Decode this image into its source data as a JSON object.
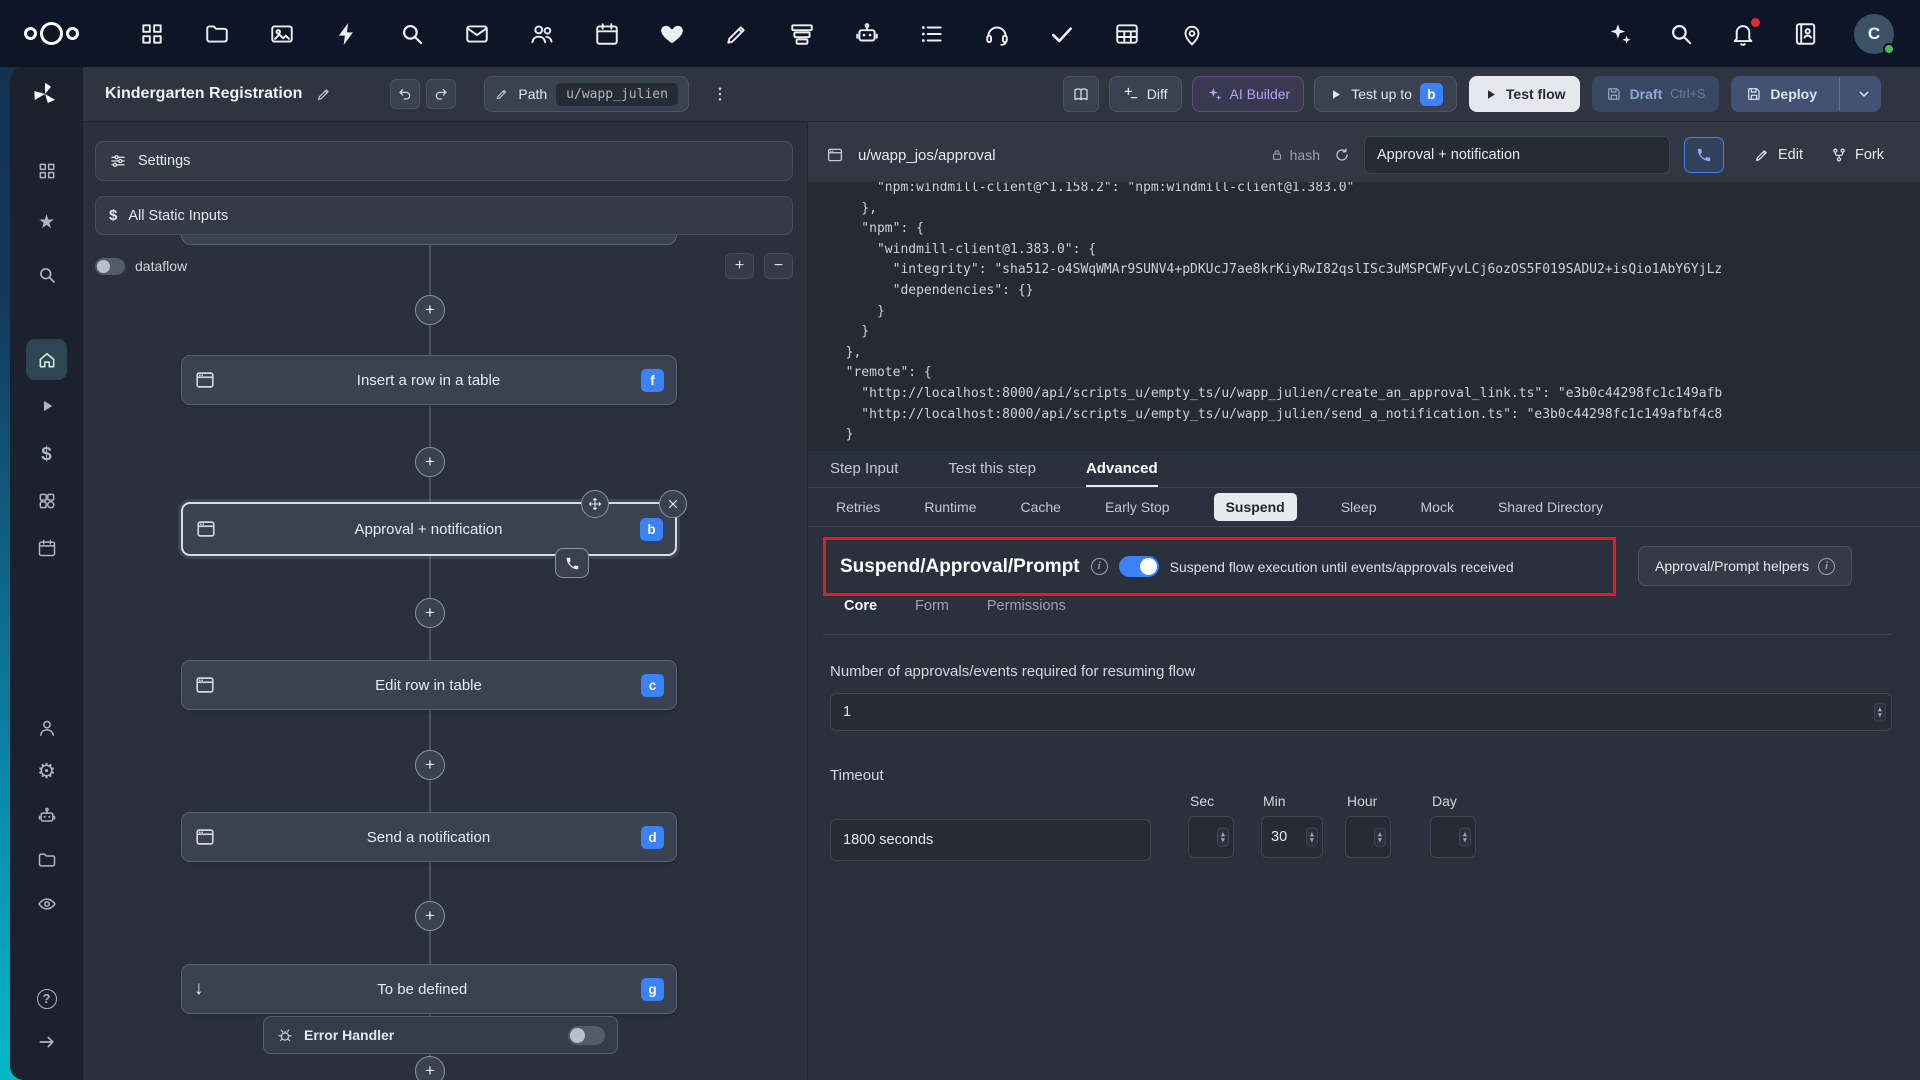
{
  "topbar": {
    "logo": "nextcloud-logo",
    "app_icons": [
      "dashboard",
      "files",
      "photos",
      "activity",
      "search-app",
      "mail",
      "contacts",
      "calendar",
      "health",
      "notes",
      "deck",
      "assistant",
      "tasks-list",
      "talk",
      "tasks",
      "tables",
      "maps"
    ],
    "right_icons": [
      "ai-sparkles",
      "unified-search",
      "notifications",
      "contacts-menu"
    ],
    "avatar_letter": "C"
  },
  "sidebar": {
    "icons": [
      "windmill-logo",
      "apps",
      "favorites",
      "search",
      "home",
      "runs",
      "variables",
      "resources",
      "schedules",
      "users",
      "settings",
      "workers",
      "folders",
      "audit-logs",
      "help",
      "expand"
    ],
    "active": "home"
  },
  "header": {
    "flow_title": "Kindergarten Registration",
    "path_label": "Path",
    "path_value": "u/wapp_julien",
    "diff_label": "Diff",
    "ai_builder_label": "AI Builder",
    "test_up_to_label": "Test up to",
    "test_up_to_badge": "b",
    "test_flow_label": "Test flow",
    "draft_label": "Draft",
    "draft_shortcut": "Ctrl+S",
    "deploy_label": "Deploy"
  },
  "flow_panel": {
    "settings_label": "Settings",
    "static_inputs_label": "All Static Inputs",
    "dataflow_label": "dataflow",
    "zoom_in": "+",
    "zoom_out": "−",
    "plus": "+",
    "tbd_arrow": "↓",
    "nodes": [
      {
        "label": "Insert a row in a table",
        "badge": "f"
      },
      {
        "label": "Approval + notification",
        "badge": "b"
      },
      {
        "label": "Edit row in table",
        "badge": "c"
      },
      {
        "label": "Send a notification",
        "badge": "d"
      },
      {
        "label": "To be defined",
        "badge": "g"
      }
    ],
    "error_handler_label": "Error Handler"
  },
  "step_panel": {
    "script_path": "u/wapp_jos/approval",
    "hash_label": "hash",
    "summary_value": "Approval + notification",
    "edit_label": "Edit",
    "fork_label": "Fork",
    "code": "      \"npm:windmill-client@^1.158.2\": \"npm:windmill-client@1.383.0\"\n    },\n    \"npm\": {\n      \"windmill-client@1.383.0\": {\n        \"integrity\": \"sha512-o4SWqWMAr9SUNV4+pDKUcJ7ae8krKiyRwI82qslISc3uMSPCWFyvLCj6ozOS5F019SADU2+isQio1AbY6YjLz\n        \"dependencies\": {}\n      }\n    }\n  },\n  \"remote\": {\n    \"http://localhost:8000/api/scripts_u/empty_ts/u/wapp_julien/create_an_approval_link.ts\": \"e3b0c44298fc1c149afb\n    \"http://localhost:8000/api/scripts_u/empty_ts/u/wapp_julien/send_a_notification.ts\": \"e3b0c44298fc1c149afbf4c8\n  }",
    "tabs": [
      "Step Input",
      "Test this step",
      "Advanced"
    ],
    "active_tab": "Advanced",
    "advanced_tabs": [
      "Retries",
      "Runtime",
      "Cache",
      "Early Stop",
      "Suspend",
      "Sleep",
      "Mock",
      "Shared Directory"
    ],
    "active_advanced_tab": "Suspend",
    "suspend": {
      "title": "Suspend/Approval/Prompt",
      "toggle_on": true,
      "description": "Suspend flow execution until events/approvals received",
      "helpers_label": "Approval/Prompt helpers",
      "tabs": [
        "Core",
        "Form",
        "Permissions"
      ],
      "active_tab": "Core",
      "approvals_label": "Number of approvals/events required for resuming flow",
      "approvals_value": "1",
      "timeout_label": "Timeout",
      "timeout_value": "1800 seconds",
      "units": [
        "Sec",
        "Min",
        "Hour",
        "Day"
      ],
      "unit_values": {
        "sec": "",
        "min": "30",
        "hour": "",
        "day": ""
      }
    }
  },
  "colors": {
    "accent_blue": "#3b82f6",
    "annotation_red": "#e01b24",
    "ai_purple": "#b5a3f8"
  }
}
